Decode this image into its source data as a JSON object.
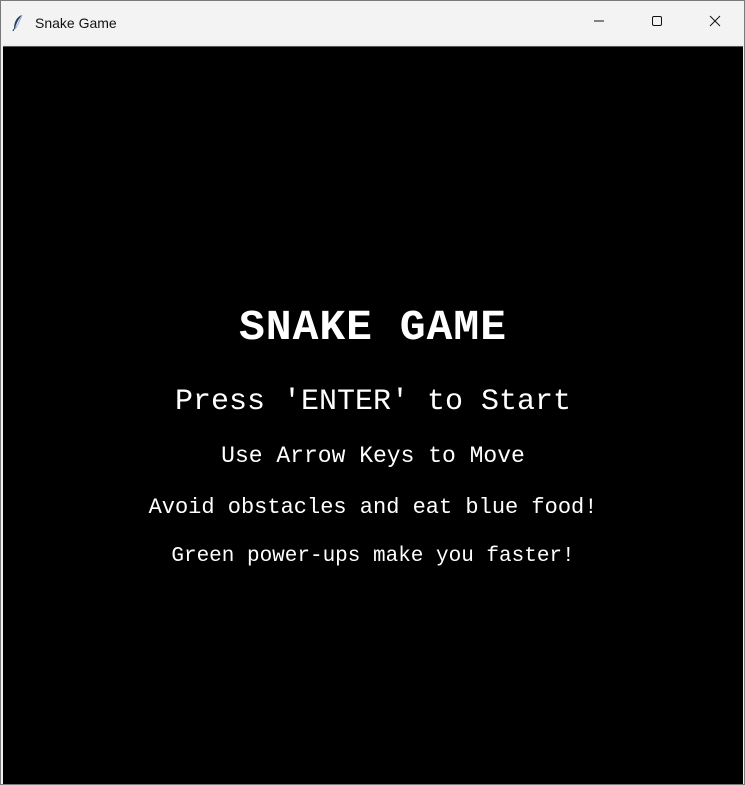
{
  "window": {
    "title": "Snake Game",
    "icon": "feather-icon",
    "controls": [
      "minimize-icon",
      "maximize-icon",
      "close-icon"
    ]
  },
  "screen": {
    "background_color": "#000000",
    "text_color": "#ffffff",
    "title": "SNAKE GAME",
    "start_prompt": "Press 'ENTER' to Start",
    "instruction_move": "Use Arrow Keys to Move",
    "instruction_food": "Avoid obstacles and eat blue food!",
    "instruction_powerup": "Green power-ups make you faster!"
  }
}
